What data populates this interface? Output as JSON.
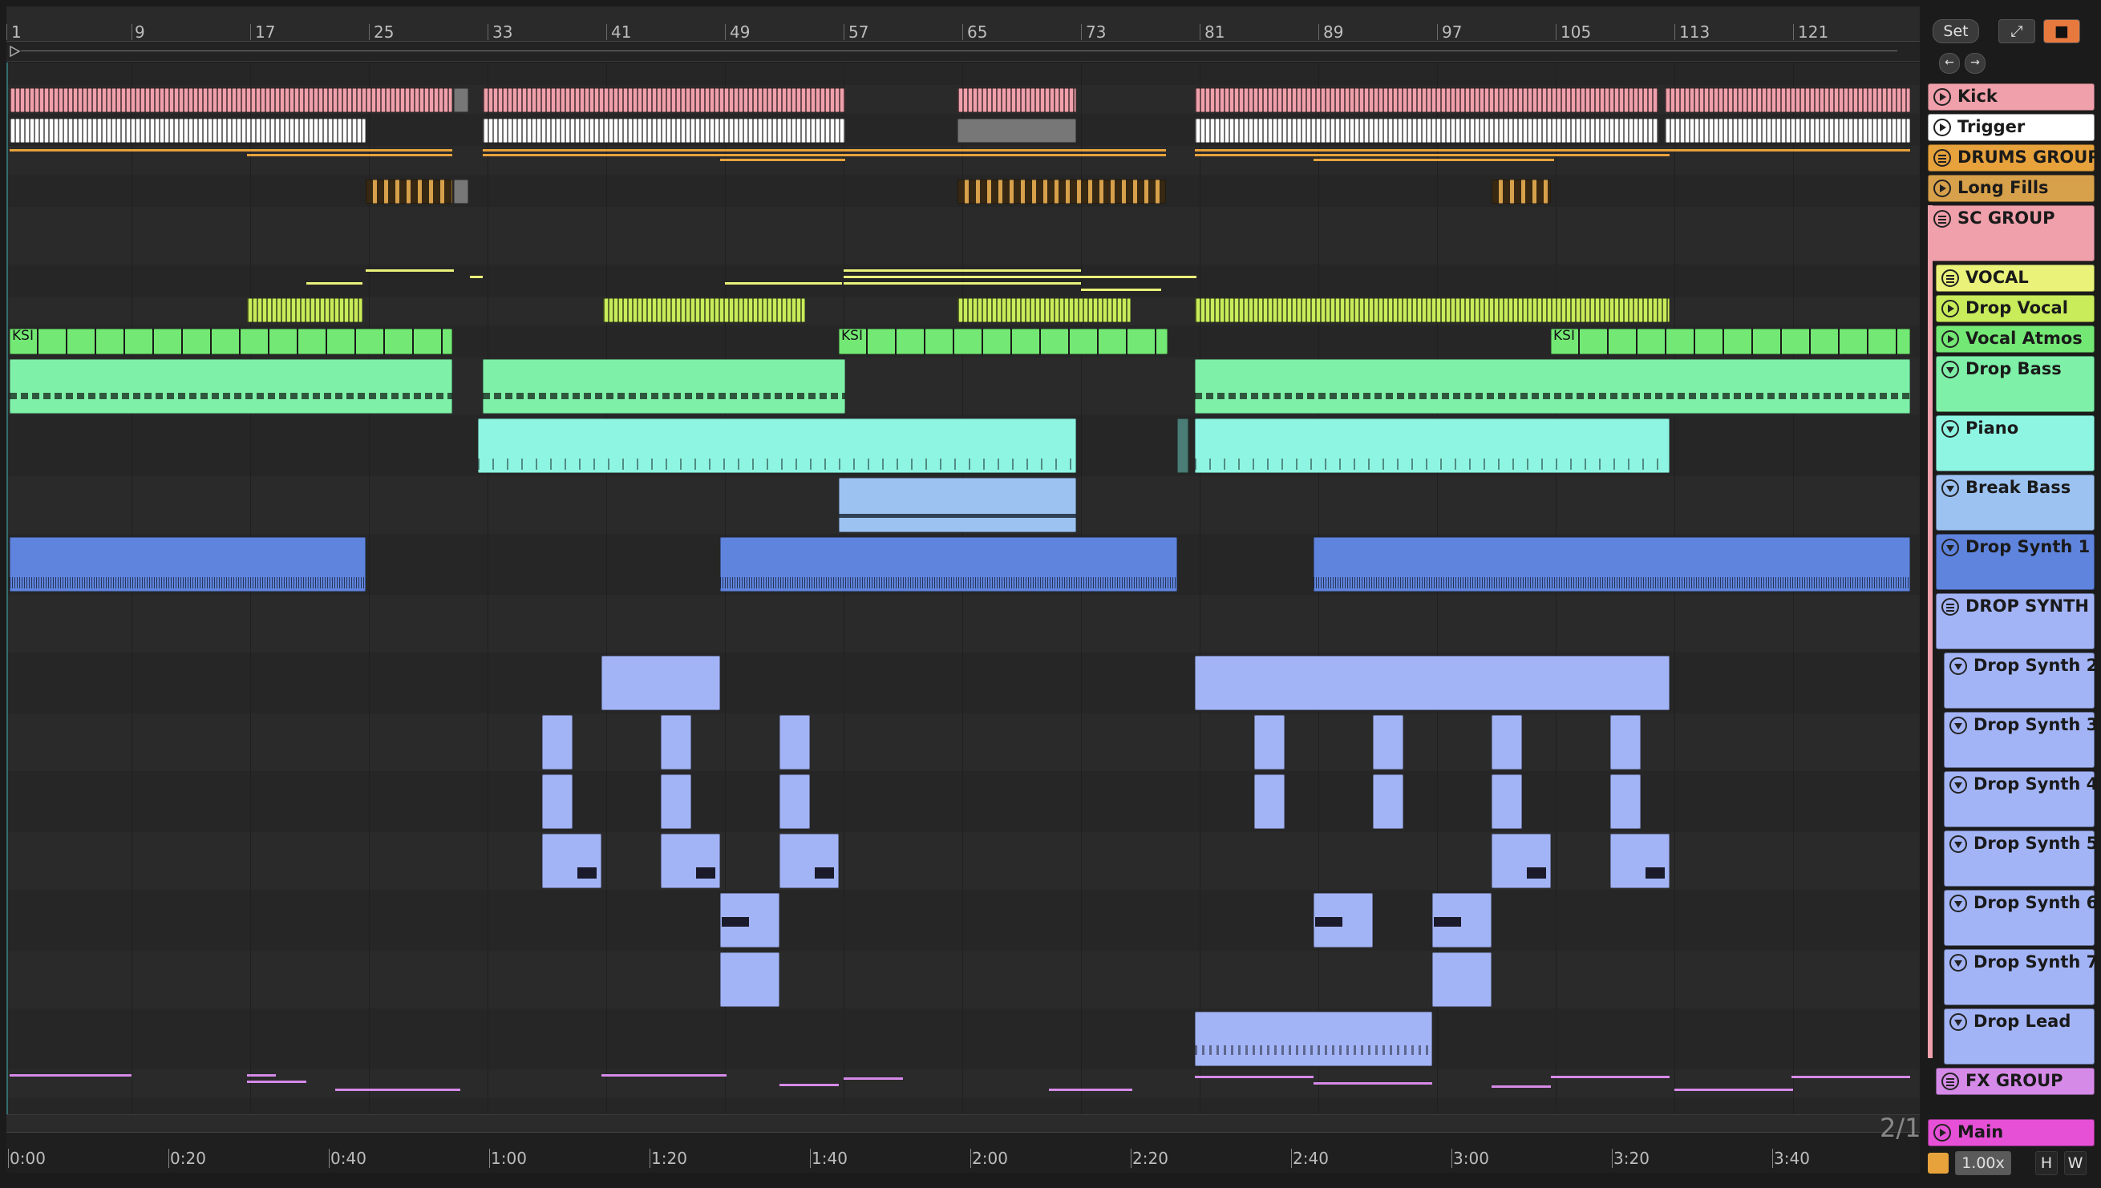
{
  "ruler": {
    "bars": [
      "1",
      "9",
      "17",
      "25",
      "33",
      "41",
      "49",
      "57",
      "65",
      "73",
      "81",
      "89",
      "97",
      "105",
      "113",
      "121"
    ]
  },
  "controls": {
    "set_label": "Set",
    "zoom_label": "1.00x",
    "h_label": "H",
    "w_label": "W",
    "page_indicator": "2/1"
  },
  "timeline": {
    "labels": [
      "0:00",
      "0:20",
      "0:40",
      "1:00",
      "1:20",
      "1:40",
      "2:00",
      "2:20",
      "2:40",
      "3:00",
      "3:20",
      "3:40"
    ]
  },
  "colors": {
    "kick": "#f0a0ab",
    "trigger": "#ffffff",
    "drums": "#e7a23c",
    "fills": "#d7a04a",
    "sc": "#f0a0ab",
    "vocal": "#eaf27a",
    "drop_vocal": "#c8ec5a",
    "atmos": "#74e874",
    "bass": "#7ff0a8",
    "piano": "#8ef5e3",
    "break": "#9cc2f2",
    "synth1": "#5f84dd",
    "synth": "#a3b4f6",
    "fx": "#d58ae8",
    "main": "#e650d6"
  },
  "clip_label": "KSI",
  "tracks": [
    {
      "name": "Kick",
      "icon": "play",
      "color": "#f0a0ab"
    },
    {
      "name": "Trigger",
      "icon": "play",
      "color": "#ffffff"
    },
    {
      "name": "DRUMS GROUP",
      "icon": "grp",
      "color": "#e7a23c"
    },
    {
      "name": "Long Fills",
      "icon": "play",
      "color": "#d7a04a"
    },
    {
      "name": "SC GROUP",
      "icon": "grp",
      "color": "#f0a0ab"
    },
    {
      "name": "VOCAL",
      "icon": "grp",
      "color": "#eaf27a"
    },
    {
      "name": "Drop Vocal",
      "icon": "play",
      "color": "#c8ec5a"
    },
    {
      "name": "Vocal Atmos",
      "icon": "play",
      "color": "#74e874"
    },
    {
      "name": "Drop Bass",
      "icon": "fold",
      "color": "#7ff0a8"
    },
    {
      "name": "Piano",
      "icon": "fold",
      "color": "#8ef5e3"
    },
    {
      "name": "Break Bass",
      "icon": "fold",
      "color": "#9cc2f2"
    },
    {
      "name": "Drop Synth 1",
      "icon": "fold",
      "color": "#5f84dd"
    },
    {
      "name": "DROP SYNTH",
      "icon": "grp",
      "color": "#a3b4f6"
    },
    {
      "name": "Drop Synth 2",
      "icon": "fold",
      "color": "#a3b4f6"
    },
    {
      "name": "Drop Synth 3",
      "icon": "fold",
      "color": "#a3b4f6"
    },
    {
      "name": "Drop Synth 4",
      "icon": "fold",
      "color": "#a3b4f6"
    },
    {
      "name": "Drop Synth 5",
      "icon": "fold",
      "color": "#a3b4f6"
    },
    {
      "name": "Drop Synth 6",
      "icon": "fold",
      "color": "#a3b4f6"
    },
    {
      "name": "Drop Synth 7",
      "icon": "fold",
      "color": "#a3b4f6"
    },
    {
      "name": "Drop Lead",
      "icon": "fold",
      "color": "#a3b4f6"
    },
    {
      "name": "FX GROUP",
      "icon": "grp",
      "color": "#d58ae8"
    },
    {
      "name": "Main",
      "icon": "play",
      "color": "#e650d6"
    }
  ]
}
